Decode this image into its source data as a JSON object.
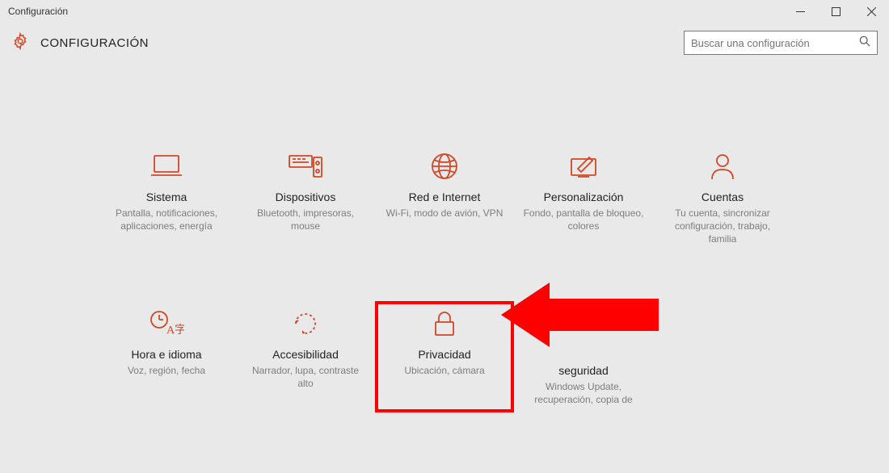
{
  "window": {
    "title": "Configuración"
  },
  "header": {
    "title": "CONFIGURACIÓN"
  },
  "search": {
    "placeholder": "Buscar una configuración"
  },
  "colors": {
    "accent": "#d24726",
    "highlight": "#ff0000"
  },
  "tiles": [
    {
      "icon": "laptop",
      "title": "Sistema",
      "desc": "Pantalla, notificaciones, aplicaciones, energía"
    },
    {
      "icon": "devices",
      "title": "Dispositivos",
      "desc": "Bluetooth, impresoras, mouse"
    },
    {
      "icon": "globe",
      "title": "Red e Internet",
      "desc": "Wi-Fi, modo de avión, VPN"
    },
    {
      "icon": "personal",
      "title": "Personalización",
      "desc": "Fondo, pantalla de bloqueo, colores"
    },
    {
      "icon": "person",
      "title": "Cuentas",
      "desc": "Tu cuenta, sincronizar configuración, trabajo, familia"
    },
    {
      "icon": "time",
      "title": "Hora e idioma",
      "desc": "Voz, región, fecha"
    },
    {
      "icon": "access",
      "title": "Accesibilidad",
      "desc": "Narrador, lupa, contraste alto"
    },
    {
      "icon": "lock",
      "title": "Privacidad",
      "desc": "Ubicación, cámara",
      "highlighted": true
    },
    {
      "icon": "update",
      "title": "Actualización y seguridad",
      "desc": "Windows Update, recuperación, copia de"
    }
  ]
}
